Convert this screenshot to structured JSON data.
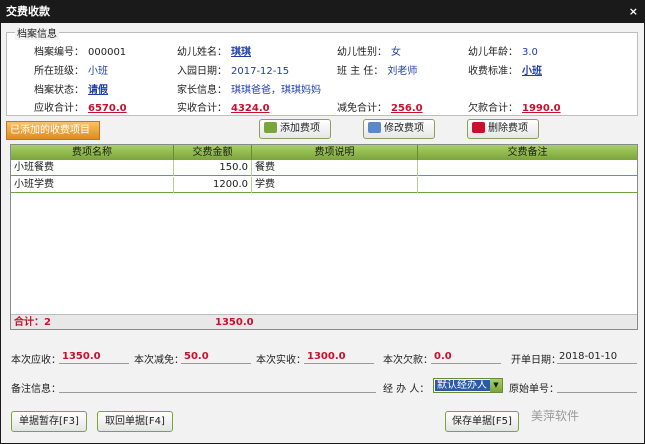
{
  "window": {
    "title": "交费收款",
    "close": "×"
  },
  "info": {
    "legend": "档案信息",
    "rows": [
      [
        {
          "label": "档案编号：",
          "value": "000001",
          "style": "plain"
        },
        {
          "label": "幼儿姓名：",
          "value": "琪琪",
          "style": "blue-b"
        },
        {
          "label": "幼儿性别：",
          "value": "女",
          "style": "blue"
        },
        {
          "label": "幼儿年龄：",
          "value": "3.0",
          "style": "blue"
        }
      ],
      [
        {
          "label": "所在班级：",
          "value": "小班",
          "style": "blue"
        },
        {
          "label": "入园日期：",
          "value": "2017-12-15",
          "style": "blue"
        },
        {
          "label": "班 主 任：",
          "value": "刘老师",
          "style": "blue"
        },
        {
          "label": "收费标准：",
          "value": "小班",
          "style": "blue-b"
        }
      ],
      [
        {
          "label": "档案状态：",
          "value": "请假",
          "style": "blue-b"
        },
        {
          "label": "家长信息：",
          "value": "琪琪爸爸，琪琪妈妈",
          "style": "blue"
        },
        {
          "label": "",
          "value": "",
          "style": "plain"
        },
        {
          "label": "",
          "value": "",
          "style": "plain"
        }
      ],
      [
        {
          "label": "应收合计：",
          "value": "6570.0",
          "style": "red-b"
        },
        {
          "label": "实收合计：",
          "value": "4324.0",
          "style": "red-b"
        },
        {
          "label": "减免合计：",
          "value": "256.0",
          "style": "red-b"
        },
        {
          "label": "欠款合计：",
          "value": "1990.0",
          "style": "red-b"
        }
      ]
    ]
  },
  "tabs": {
    "active": "已添加的收费项目"
  },
  "toolbar": {
    "add": "添加费项",
    "edit": "修改费项",
    "delete": "删除费项"
  },
  "grid": {
    "headers": [
      "费项名称",
      "交费金额",
      "费项说明",
      "交费备注"
    ],
    "rows": [
      [
        "小班餐费",
        "150.0",
        "餐费",
        ""
      ],
      [
        "小班学费",
        "1200.0",
        "学费",
        ""
      ]
    ],
    "footer": {
      "label": "合计：2",
      "amount": "1350.0"
    }
  },
  "form": {
    "due_label": "本次应收：",
    "due_value": "1350.0",
    "reduce_label": "本次减免：",
    "reduce_value": "50.0",
    "paid_label": "本次实收：",
    "paid_value": "1300.0",
    "owe_label": "本次欠款：",
    "owe_value": "0.0",
    "date_label": "开单日期：",
    "date_value": "2018-01-10",
    "note_label": "备注信息：",
    "note_value": "",
    "handler_label": "经 办 人：",
    "handler_value": "默认经办人",
    "orig_label": "原始单号：",
    "orig_value": ""
  },
  "buttons": {
    "hold": "单据暂存[F3]",
    "recall": "取回单据[F4]",
    "save": "保存单据[F5]"
  },
  "watermark": "美萍软件",
  "colors": {
    "accent_green": "#7aa53a",
    "value_red": "#c8102e",
    "value_blue": "#1e3fa8",
    "tab_orange": "#e08a1e"
  }
}
